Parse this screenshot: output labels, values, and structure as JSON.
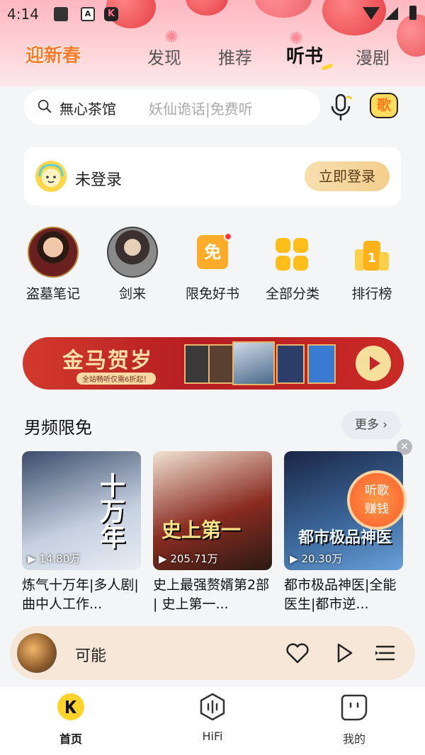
{
  "status": {
    "time": "4:14"
  },
  "nav": {
    "festival": "迎新春",
    "tabs": [
      {
        "label": "发现",
        "active": false
      },
      {
        "label": "推荐",
        "active": false
      },
      {
        "label": "听书",
        "active": true
      },
      {
        "label": "漫剧",
        "active": false
      }
    ]
  },
  "search": {
    "value": "無心茶馆",
    "hint": "妖仙诡话|免费听"
  },
  "song_button": "歌",
  "login": {
    "status": "未登录",
    "button": "立即登录"
  },
  "quick": [
    {
      "label": "盗墓笔记",
      "icon": "daomu-portrait"
    },
    {
      "label": "剑来",
      "icon": "jianlai-portrait"
    },
    {
      "label": "限免好书",
      "icon": "free-icon",
      "glyph": "免",
      "has_badge": true
    },
    {
      "label": "全部分类",
      "icon": "grid-icon"
    },
    {
      "label": "排行榜",
      "icon": "rank-icon",
      "glyph": "1"
    }
  ],
  "banner": {
    "title": "金马贺岁",
    "subtitle": "全站畅听仅需6折起！"
  },
  "section": {
    "title": "男频限免",
    "more": "更多 ›"
  },
  "books": [
    {
      "title": "炼气十万年|多人剧|曲中人工作...",
      "plays": "14.80万",
      "cover_text": "十万年"
    },
    {
      "title": "史上最强赘婿第2部 | 史上第一...",
      "plays": "205.71万",
      "cover_text": "史上第一"
    },
    {
      "title": "都市极品神医|全能医生|都市逆...",
      "plays": "20.30万",
      "cover_text": "都市极品神医"
    }
  ],
  "earn_badge": {
    "line1": "听歌",
    "line2": "赚钱"
  },
  "player": {
    "title": "可能"
  },
  "bottom_nav": [
    {
      "label": "首页",
      "active": true
    },
    {
      "label": "HiFi",
      "active": false
    },
    {
      "label": "我的",
      "active": false
    }
  ],
  "colors": {
    "accent": "#ffd22c",
    "festival": "#ff7a2a",
    "banner": "#c3262a",
    "player_bg": "#f6e7d8"
  }
}
